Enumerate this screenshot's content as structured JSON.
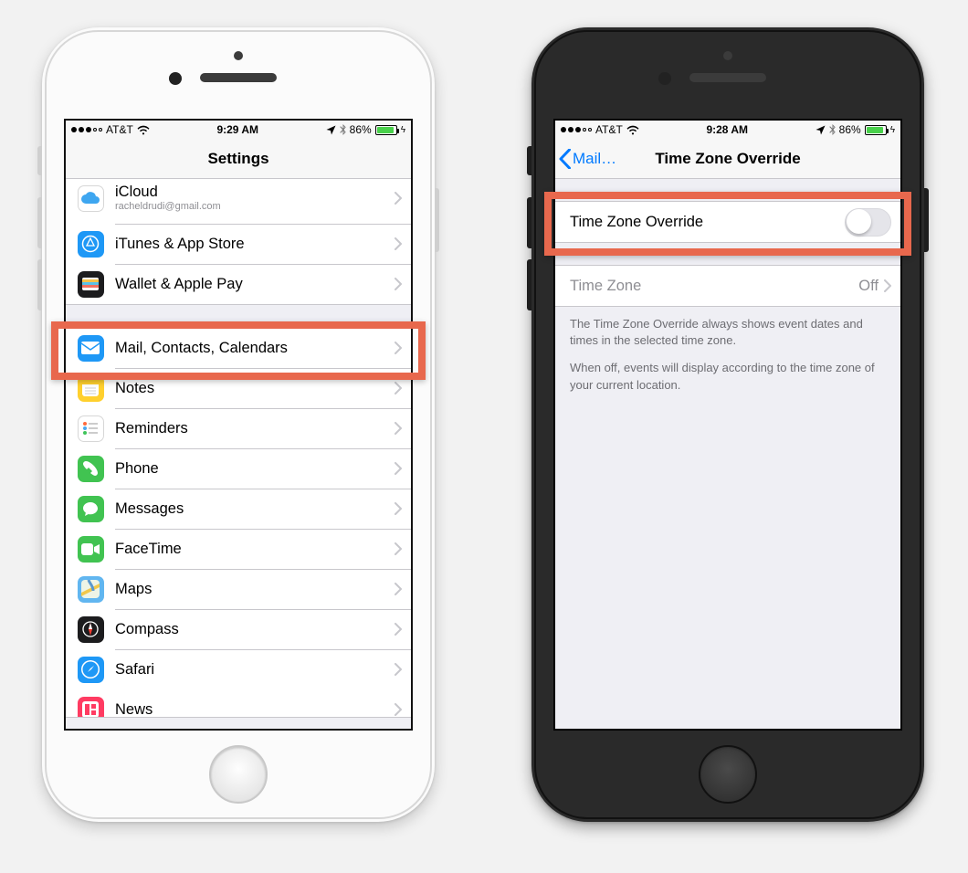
{
  "left": {
    "status": {
      "carrier": "AT&T",
      "time": "9:29 AM",
      "battery_pct": "86%"
    },
    "nav_title": "Settings",
    "groups": [
      {
        "key": "g1",
        "rows": [
          {
            "key": "icloud",
            "label": "iCloud",
            "sub": "racheldrudi@gmail.com",
            "icon": "cloud",
            "bg": "#ffffff",
            "fg": "#3ea6f0",
            "border": true,
            "tall": true
          },
          {
            "key": "itunes",
            "label": "iTunes & App Store",
            "icon": "appstore",
            "bg": "#1e98f6"
          },
          {
            "key": "wallet",
            "label": "Wallet & Apple Pay",
            "icon": "wallet",
            "bg": "#1c1c1e"
          }
        ]
      },
      {
        "key": "g2",
        "rows": [
          {
            "key": "mail",
            "label": "Mail, Contacts, Calendars",
            "icon": "mail",
            "bg": "#1e98f6"
          },
          {
            "key": "notes",
            "label": "Notes",
            "icon": "notes",
            "bg": "#ffd02e",
            "fg": "#b08a00"
          },
          {
            "key": "reminders",
            "label": "Reminders",
            "icon": "reminders",
            "bg": "#ffffff",
            "border": true
          },
          {
            "key": "phone",
            "label": "Phone",
            "icon": "phone",
            "bg": "#41c351"
          },
          {
            "key": "messages",
            "label": "Messages",
            "icon": "bubble",
            "bg": "#41c351"
          },
          {
            "key": "facetime",
            "label": "FaceTime",
            "icon": "video",
            "bg": "#41c351"
          },
          {
            "key": "maps",
            "label": "Maps",
            "icon": "maps",
            "bg": "#61b6f0"
          },
          {
            "key": "compass",
            "label": "Compass",
            "icon": "compass",
            "bg": "#1c1c1e"
          },
          {
            "key": "safari",
            "label": "Safari",
            "icon": "safari",
            "bg": "#1e98f6"
          },
          {
            "key": "news",
            "label": "News",
            "icon": "news",
            "bg": "#ff3b62"
          }
        ]
      }
    ]
  },
  "right": {
    "status": {
      "carrier": "AT&T",
      "time": "9:28 AM",
      "battery_pct": "86%"
    },
    "nav_back": "Mail…",
    "nav_title": "Time Zone Override",
    "toggle_row": {
      "label": "Time Zone Override",
      "on": false
    },
    "tz_row": {
      "label": "Time Zone",
      "value": "Off"
    },
    "footer1": "The Time Zone Override always shows event dates and times in the selected time zone.",
    "footer2": "When off, events will display according to the time zone of your current location."
  }
}
